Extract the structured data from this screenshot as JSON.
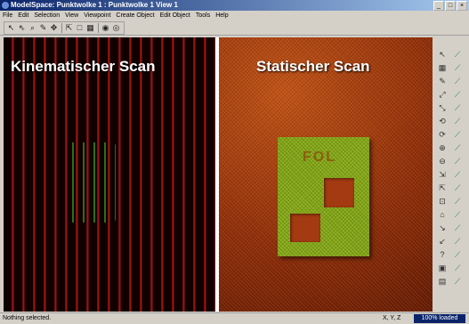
{
  "window": {
    "title": "ModelSpace: Punktwolke 1 : Punktwolke 1 View 1",
    "controls": [
      "_",
      "□",
      "×"
    ]
  },
  "menu": [
    "File",
    "Edit",
    "Selection",
    "View",
    "Viewpoint",
    "Create Object",
    "Edit Object",
    "Tools",
    "Help"
  ],
  "toolbar": {
    "tools": [
      "select-arrow",
      "select-arrow-alt",
      "zoom",
      "pencil",
      "move",
      "fit",
      "rectangle",
      "grid",
      "camera",
      "camera-alt"
    ]
  },
  "viewport": {
    "left_label": "Kinematischer Scan",
    "right_label": "Statischer Scan",
    "plate_mark": "FOL"
  },
  "right_toolbar": {
    "column_a": [
      "↖",
      "▦",
      "✎",
      "⤢",
      "⤡",
      "⟲",
      "⟳",
      "⊕",
      "⊖",
      "⇲",
      "⇱",
      "⊡",
      "⌂",
      "↘",
      "↙",
      "?",
      "▣",
      "▤"
    ],
    "column_b": [
      "⟋",
      "⟋",
      "⟋",
      "⟋",
      "⟋",
      "⟋",
      "⟋",
      "⟋",
      "⟋",
      "⟋",
      "⟋",
      "⟋",
      "⟋",
      "⟋",
      "⟋",
      "⟋",
      "⟋",
      "⟋"
    ]
  },
  "status": {
    "message": "Nothing selected.",
    "coords": "X, Y, Z",
    "zoom": "100% loaded"
  },
  "colors": {
    "titlebar_start": "#0a246a",
    "titlebar_end": "#a6caf0",
    "scan_green": "#7fa21a",
    "scan_red": "#c0551a"
  }
}
